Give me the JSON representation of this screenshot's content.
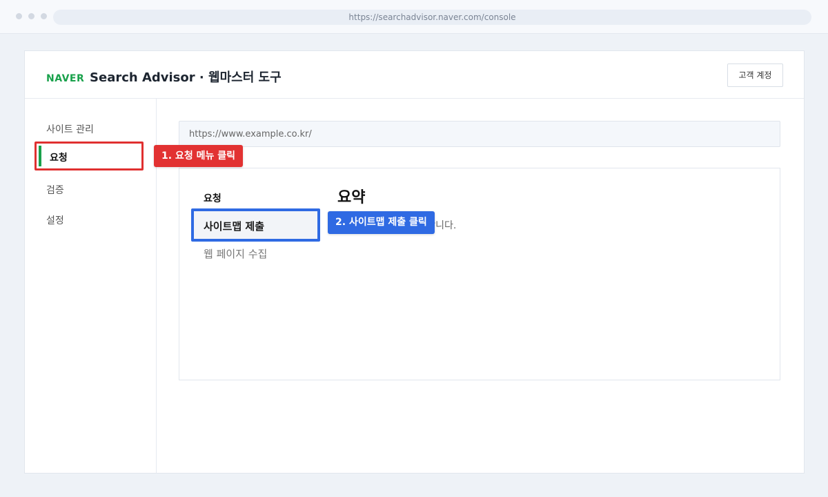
{
  "browser": {
    "url": "https://searchadvisor.naver.com/console"
  },
  "header": {
    "brand": "NAVER",
    "title": "Search Advisor · 웹마스터 도구",
    "account_button": "고객 계정"
  },
  "sidebar": {
    "items": [
      {
        "label": "사이트 관리"
      },
      {
        "label": "요청"
      },
      {
        "label": "검증"
      },
      {
        "label": "설정"
      }
    ]
  },
  "callouts": {
    "step1": "1. 요청 메뉴 클릭",
    "step2": "2. 사이트맵 제출 클릭"
  },
  "main": {
    "site_url": "https://www.example.co.kr/",
    "panel": {
      "menu_heading": "요청",
      "menu_items": [
        {
          "label": "사이트맵 제출"
        },
        {
          "label": "웹 페이지 수집"
        }
      ],
      "summary_title": "요약",
      "summary_desc": "요청 기능 항목을 확인합니다."
    }
  },
  "colors": {
    "brand_green": "#19a14b",
    "highlight_red": "#e23232",
    "highlight_blue": "#2f6ae3"
  },
  "icons": [
    "window-dot-icon"
  ]
}
